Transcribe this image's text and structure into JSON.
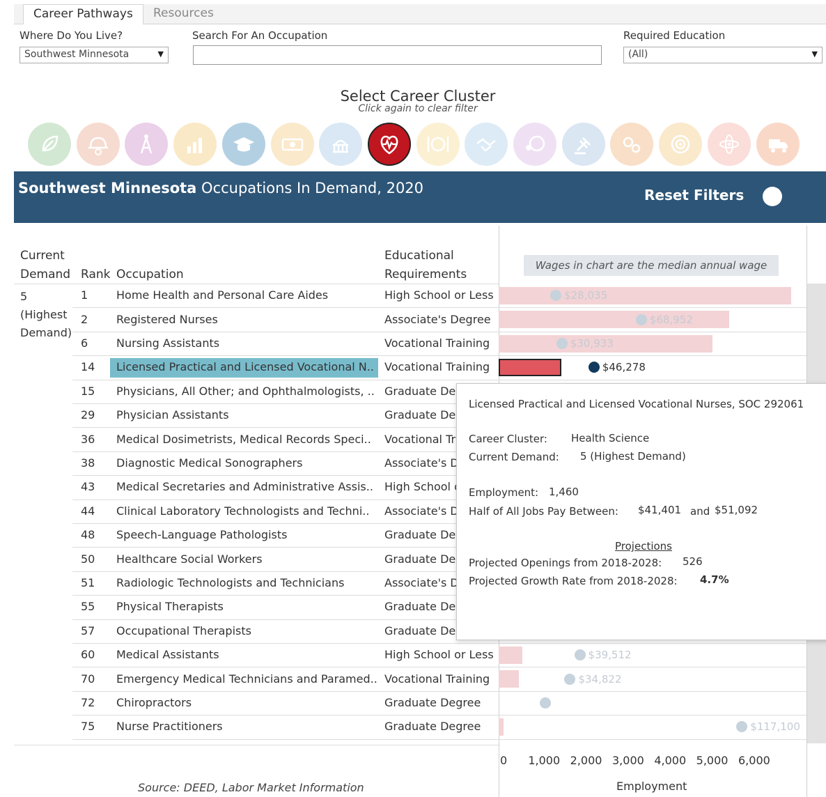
{
  "tabs": [
    {
      "label": "Career Pathways",
      "active": true
    },
    {
      "label": "Resources",
      "active": false
    }
  ],
  "filters": {
    "location_label": "Where Do You Live?",
    "location_value": "Southwest Minnesota",
    "search_label": "Search For An Occupation",
    "search_value": "",
    "education_label": "Required Education",
    "education_value": "(All)"
  },
  "cluster": {
    "title": "Select Career Cluster",
    "subtitle": "Click again to clear filter",
    "icons": [
      {
        "name": "leaf-icon",
        "color": "#8bc48a",
        "selected": false
      },
      {
        "name": "helmet-gear-icon",
        "color": "#e9a385",
        "selected": false
      },
      {
        "name": "antenna-icon",
        "color": "#c986c6",
        "selected": false
      },
      {
        "name": "chart-growth-icon",
        "color": "#f2c66e",
        "selected": false
      },
      {
        "name": "graduation-cap-icon",
        "color": "#3a86b7",
        "selected": false
      },
      {
        "name": "money-icon",
        "color": "#f6c67a",
        "selected": false
      },
      {
        "name": "capitol-icon",
        "color": "#9ec3e4",
        "selected": false
      },
      {
        "name": "heart-pulse-icon",
        "color": "#c0161f",
        "selected": true
      },
      {
        "name": "dining-icon",
        "color": "#f7d88a",
        "selected": false
      },
      {
        "name": "handshake-icon",
        "color": "#a7cce8",
        "selected": false
      },
      {
        "name": "globe-person-icon",
        "color": "#d7b3e0",
        "selected": false
      },
      {
        "name": "gavel-icon",
        "color": "#9fc0df",
        "selected": false
      },
      {
        "name": "gears-icon",
        "color": "#f0ae6e",
        "selected": false
      },
      {
        "name": "target-icon",
        "color": "#f5c77a",
        "selected": false
      },
      {
        "name": "atom-icon",
        "color": "#f7a7a0",
        "selected": false
      },
      {
        "name": "truck-icon",
        "color": "#f39a6d",
        "selected": false
      }
    ]
  },
  "banner": {
    "region": "Southwest Minnesota",
    "suffix": " Occupations In Demand, 2020",
    "reset_label": "Reset Filters"
  },
  "table": {
    "headers": {
      "demand_1": "Current",
      "demand_2": "Demand",
      "rank": "Rank",
      "occupation": "Occupation",
      "edu_1": "Educational",
      "edu_2": "Requirements"
    },
    "demand_level": [
      "5",
      "(Highest",
      "Demand)"
    ],
    "wage_note": "Wages in chart are the median annual wage",
    "rows": [
      {
        "rank": "1",
        "occupation": "Home Health and Personal Care Aides",
        "education": "High School or Less",
        "employment": 6850,
        "wage": 28035,
        "wage_label": "$28,035",
        "selected": false
      },
      {
        "rank": "2",
        "occupation": "Registered Nurses",
        "education": "Associate's Degree",
        "employment": 5400,
        "wage": 68952,
        "wage_label": "$68,952",
        "selected": false
      },
      {
        "rank": "6",
        "occupation": "Nursing Assistants",
        "education": "Vocational Training",
        "employment": 5000,
        "wage": 30933,
        "wage_label": "$30,933",
        "selected": false
      },
      {
        "rank": "14",
        "occupation": "Licensed Practical and Licensed Vocational N..",
        "education": "Vocational Training",
        "employment": 1460,
        "wage": 46278,
        "wage_label": "$46,278",
        "selected": true
      },
      {
        "rank": "15",
        "occupation": "Physicians, All Other; and Ophthalmologists, ..",
        "education": "Graduate Degree",
        "employment": null,
        "wage": null,
        "wage_label": "",
        "selected": false
      },
      {
        "rank": "29",
        "occupation": "Physician Assistants",
        "education": "Graduate Degree",
        "employment": null,
        "wage": null,
        "wage_label": "",
        "selected": false
      },
      {
        "rank": "36",
        "occupation": "Medical Dosimetrists, Medical Records Speci..",
        "education": "Vocational Training",
        "employment": null,
        "wage": null,
        "wage_label": "",
        "selected": false
      },
      {
        "rank": "38",
        "occupation": "Diagnostic Medical Sonographers",
        "education": "Associate's Degree",
        "employment": null,
        "wage": null,
        "wage_label": "",
        "selected": false
      },
      {
        "rank": "43",
        "occupation": "Medical Secretaries and Administrative Assis..",
        "education": "High School or Less",
        "employment": null,
        "wage": null,
        "wage_label": "",
        "selected": false
      },
      {
        "rank": "44",
        "occupation": "Clinical Laboratory Technologists and Techni..",
        "education": "Associate's Degree",
        "employment": null,
        "wage": null,
        "wage_label": "",
        "selected": false
      },
      {
        "rank": "48",
        "occupation": "Speech-Language Pathologists",
        "education": "Graduate Degree",
        "employment": null,
        "wage": null,
        "wage_label": "",
        "selected": false
      },
      {
        "rank": "50",
        "occupation": "Healthcare Social Workers",
        "education": "Graduate Degree",
        "employment": null,
        "wage": null,
        "wage_label": "",
        "selected": false
      },
      {
        "rank": "51",
        "occupation": "Radiologic Technologists and Technicians",
        "education": "Associate's Degree",
        "employment": null,
        "wage": null,
        "wage_label": "",
        "selected": false
      },
      {
        "rank": "55",
        "occupation": "Physical Therapists",
        "education": "Graduate Degree",
        "employment": null,
        "wage": null,
        "wage_label": "",
        "selected": false
      },
      {
        "rank": "57",
        "occupation": "Occupational Therapists",
        "education": "Graduate Degree",
        "employment": null,
        "wage": null,
        "wage_label": "",
        "selected": false
      },
      {
        "rank": "60",
        "occupation": "Medical Assistants",
        "education": "High School or Less",
        "employment": 560,
        "wage": 39512,
        "wage_label": "$39,512",
        "selected": false
      },
      {
        "rank": "70",
        "occupation": "Emergency Medical Technicians and Paramed..",
        "education": "Vocational Training",
        "employment": 470,
        "wage": 34822,
        "wage_label": "$34,822",
        "selected": false
      },
      {
        "rank": "72",
        "occupation": "Chiropractors",
        "education": "Graduate Degree",
        "employment": 0,
        "wage": 23000,
        "wage_label": "",
        "selected": false
      },
      {
        "rank": "75",
        "occupation": "Nurse Practitioners",
        "education": "Graduate Degree",
        "employment": 120,
        "wage": 117100,
        "wage_label": "$117,100",
        "selected": false
      }
    ]
  },
  "chart_data": {
    "type": "bar",
    "xlabel": "Employment",
    "xlim": [
      0,
      7000
    ],
    "ticks": [
      "0",
      "1,000",
      "2,000",
      "3,000",
      "4,000",
      "5,000",
      "6,000"
    ],
    "tick_values": [
      0,
      1000,
      2000,
      3000,
      4000,
      5000,
      6000
    ],
    "wage_axis": [
      0,
      130000
    ],
    "grid": true
  },
  "tooltip": {
    "title": "Licensed Practical and Licensed Vocational Nurses, SOC 292061",
    "cluster_label": "Career Cluster:",
    "cluster_value": "Health Science",
    "demand_label": "Current Demand:",
    "demand_value": "5 (Highest Demand)",
    "employment_label": "Employment:",
    "employment_value": "1,460",
    "pay_label": "Half of All Jobs Pay Between:",
    "pay_low": "$41,401",
    "pay_and": "and",
    "pay_high": "$51,092",
    "projections_header": "Projections",
    "openings_label": "Projected Openings from 2018-2028:",
    "openings_value": "526",
    "growth_label": "Projected Growth Rate from 2018-2028:",
    "growth_value": "4.7%"
  },
  "source": "Source: DEED, Labor Market Information"
}
